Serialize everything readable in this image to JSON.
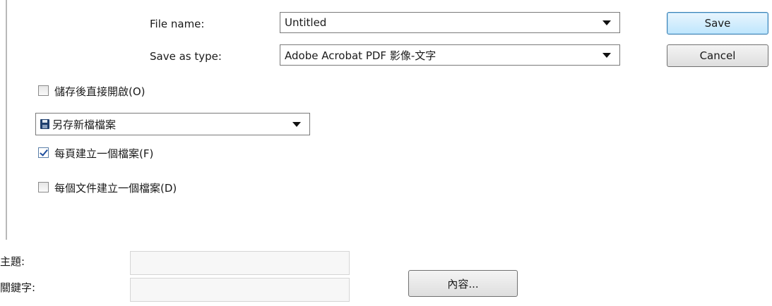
{
  "file_name": {
    "label": "File name:",
    "value": "Untitled"
  },
  "save_as_type": {
    "label": "Save as type:",
    "value": "Adobe Acrobat PDF 影像-文字"
  },
  "buttons": {
    "save": "Save",
    "cancel": "Cancel",
    "properties": "內容..."
  },
  "options": {
    "open_after_save": {
      "label": "儲存後直接開啟(O)",
      "checked": false
    },
    "save_mode": {
      "value": "另存新檔檔案"
    },
    "one_file_per_page": {
      "label": "每頁建立一個檔案(F)",
      "checked": true
    },
    "one_file_per_doc": {
      "label": "每個文件建立一個檔案(D)",
      "checked": false
    }
  },
  "metadata": {
    "subject_label": "主題:",
    "keywords_label": "關鍵字:"
  },
  "icons": {
    "dropdown": "chevron-down-icon",
    "save_mode": "floppy-disk-icon",
    "checkbox": "checkmark-icon"
  }
}
